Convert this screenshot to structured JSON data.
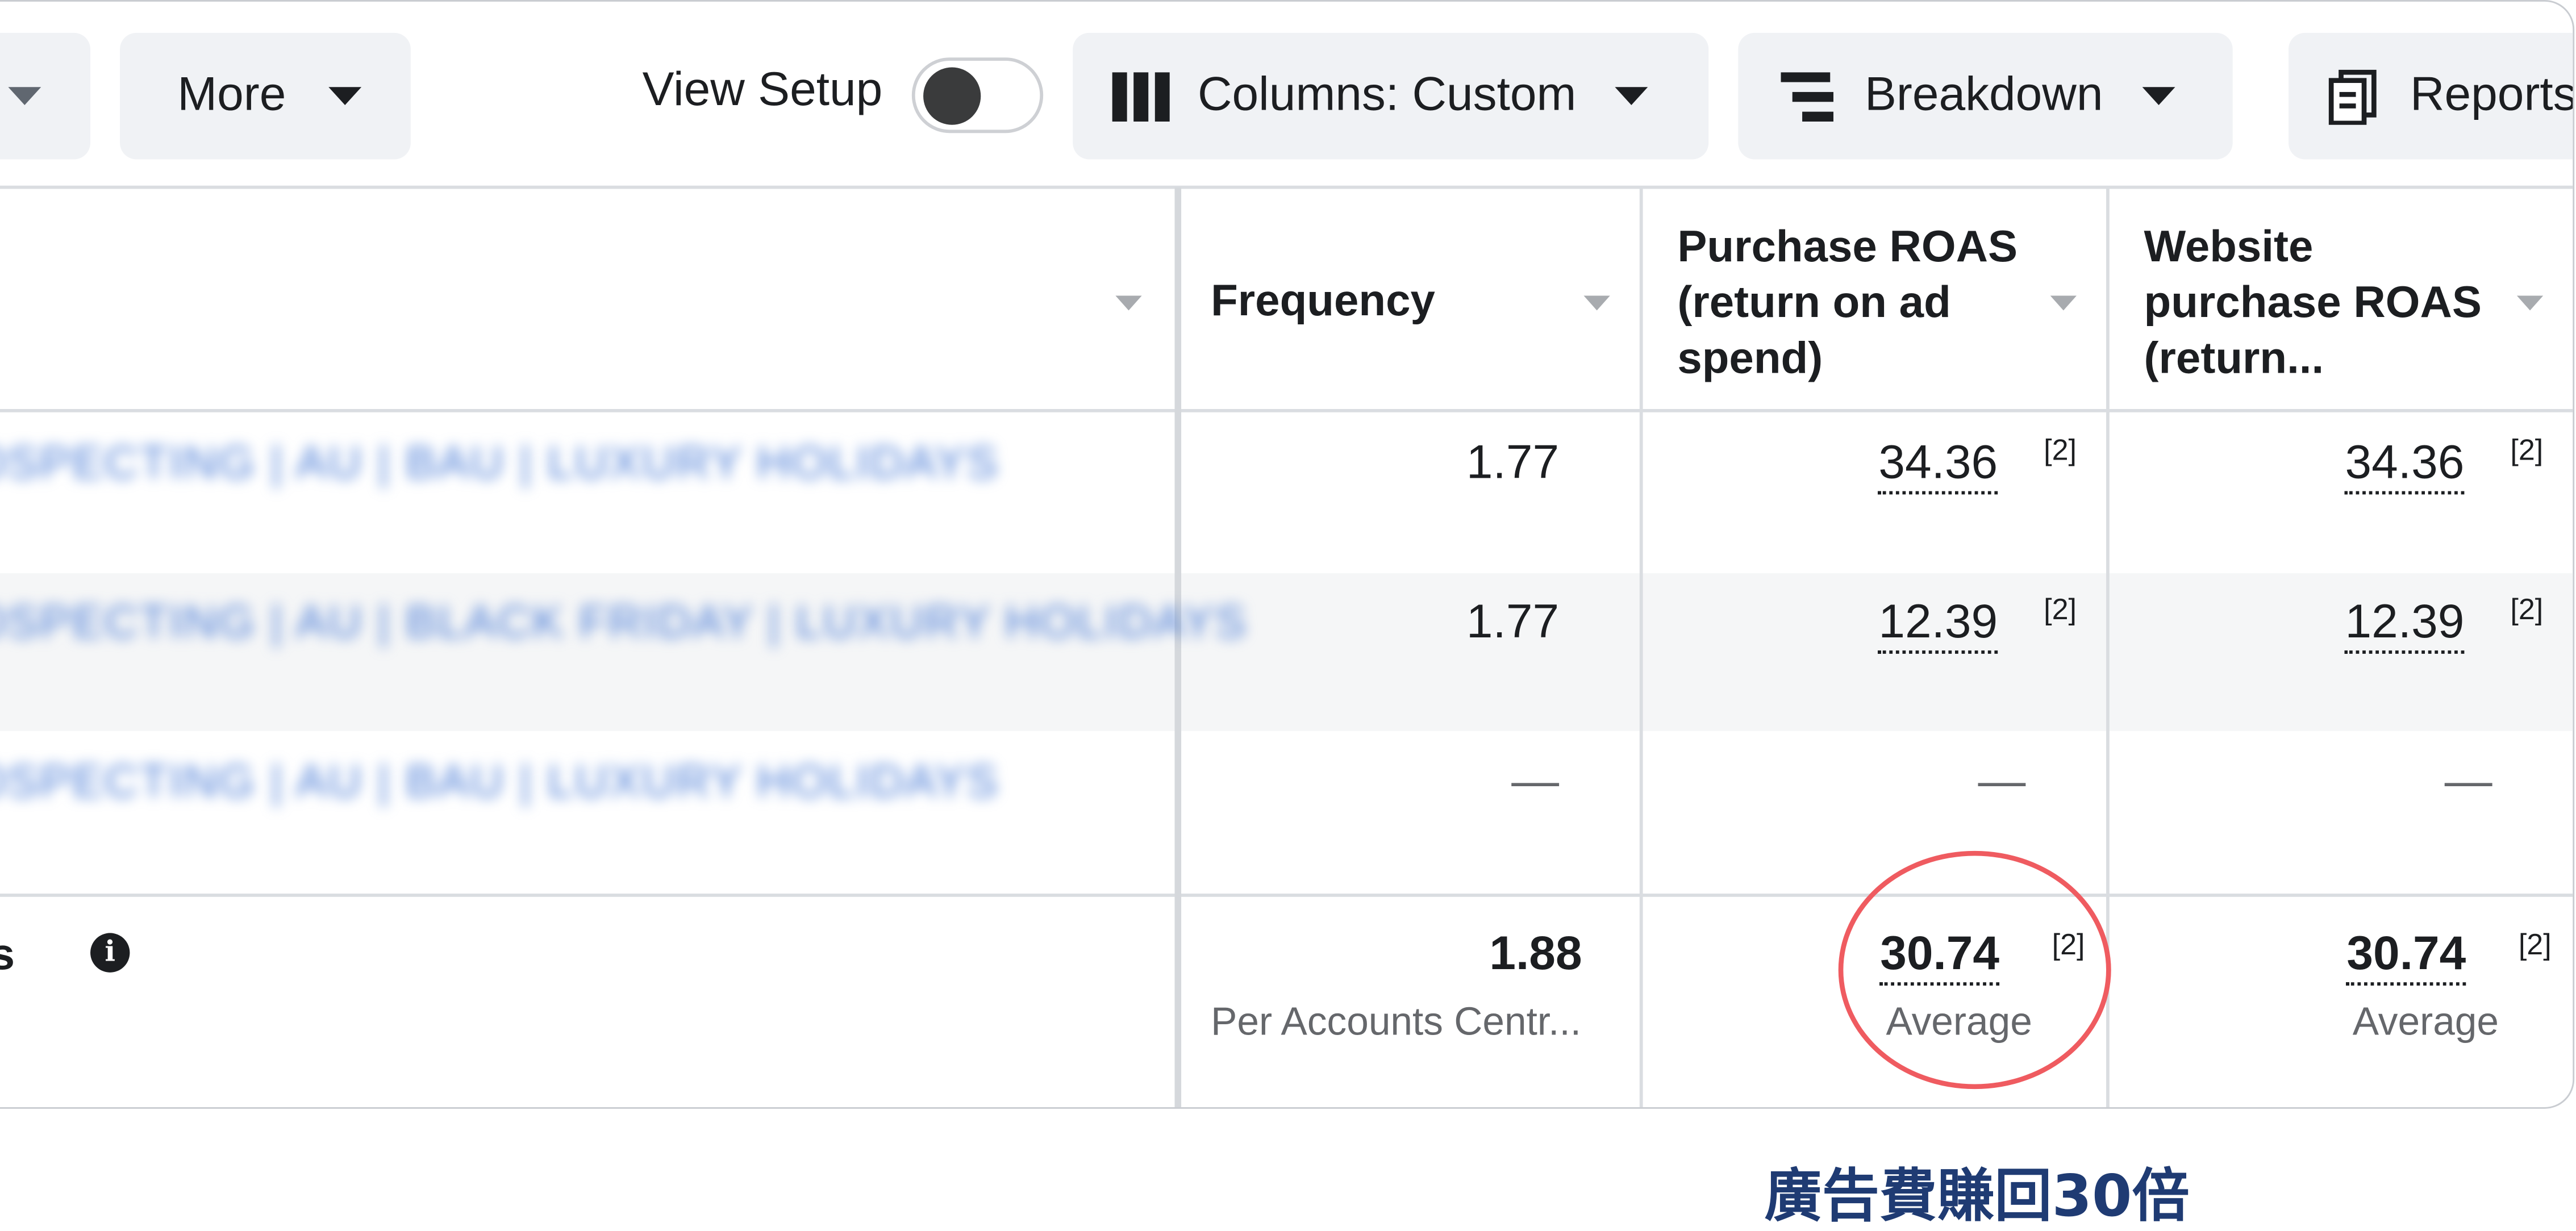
{
  "toolbar": {
    "more_label": "More",
    "view_setup_label": "View Setup",
    "view_setup_on": false,
    "columns_label": "Columns: Custom",
    "breakdown_label": "Breakdown",
    "reports_label": "Reports"
  },
  "table": {
    "columns": [
      {
        "label": ""
      },
      {
        "label": "Frequency"
      },
      {
        "label": "Purchase ROAS (return on ad spend)"
      },
      {
        "label": "Website purchase ROAS (return..."
      }
    ],
    "rows": [
      {
        "name": "PROSPECTING | AU | BAU | LUXURY HOLIDAYS",
        "frequency": "1.77",
        "purchase_roas": "34.36",
        "purchase_roas_note": "[2]",
        "website_roas": "34.36",
        "website_roas_note": "[2]"
      },
      {
        "name": "PROSPECTING | AU | BLACK FRIDAY | LUXURY HOLIDAYS",
        "frequency": "1.77",
        "purchase_roas": "12.39",
        "purchase_roas_note": "[2]",
        "website_roas": "12.39",
        "website_roas_note": "[2]"
      },
      {
        "name": "PROSPECTING | AU | BAU | LUXURY HOLIDAYS",
        "frequency": "—",
        "purchase_roas": "—",
        "website_roas": "—"
      }
    ],
    "summary": {
      "label": "gns",
      "frequency": "1.88",
      "frequency_sub": "Per Accounts Centr...",
      "purchase_roas": "30.74",
      "purchase_roas_note": "[2]",
      "purchase_roas_sub": "Average",
      "website_roas": "30.74",
      "website_roas_note": "[2]",
      "website_roas_sub": "Average"
    }
  },
  "annotation": {
    "caption": "廣告費賺回30倍",
    "ring_color": "#ef5b60"
  }
}
